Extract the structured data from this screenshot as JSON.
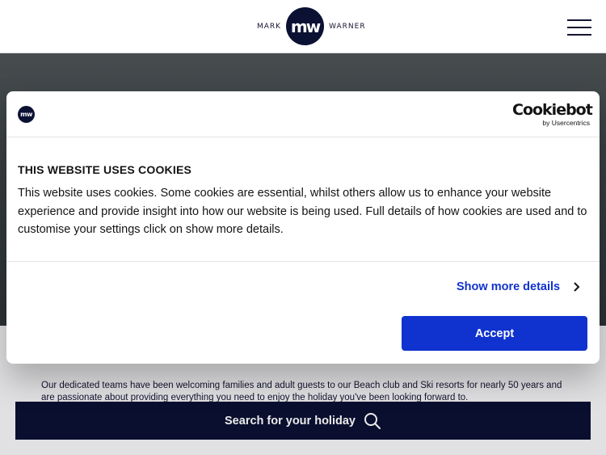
{
  "header": {
    "logo_left": "MARK",
    "logo_mark": "mw",
    "logo_right": "WARNER",
    "menu_icon": "hamburger-menu-icon"
  },
  "intro": {
    "paragraph1": "Our dedicated teams have been welcoming families and adult guests to our Beach club and Ski resorts for nearly 50 years and are passionate about providing everything you need to enjoy the holiday you've been looking forward to."
  },
  "search": {
    "label": "Search for your holiday",
    "icon": "search-icon"
  },
  "cookie_dialog": {
    "logo_mark": "mw",
    "brand_name": "Cookiebot",
    "brand_sub": "by Usercentrics",
    "title": "THIS WEBSITE USES COOKIES",
    "body": "This website uses cookies. Some cookies are essential, whilst others allow us to enhance your website experience and provide insight into how our website is being used. Full details of how cookies are used and to customise your settings click on show more details.",
    "show_more_label": "Show more details",
    "show_more_icon": "chevron-right-icon",
    "accept_label": "Accept"
  },
  "colors": {
    "brand_navy": "#0b1133",
    "accent_blue": "#1032cf"
  }
}
